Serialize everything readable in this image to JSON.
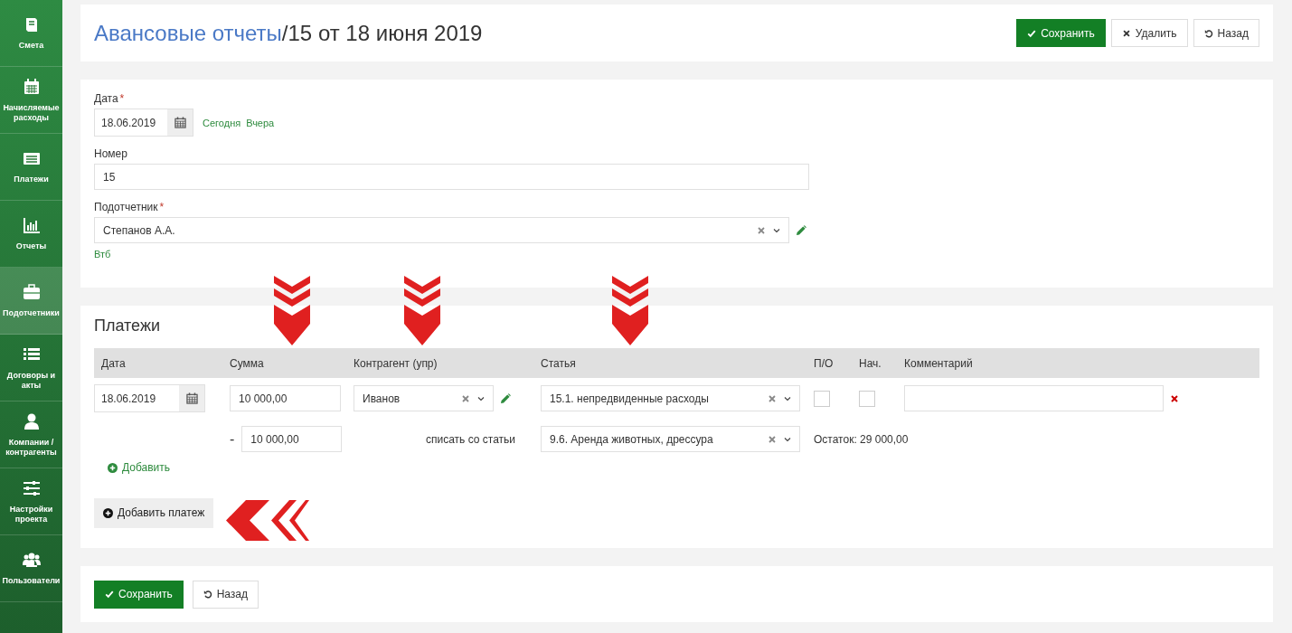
{
  "sidebar": {
    "items": [
      {
        "label": "Смета",
        "selected": false
      },
      {
        "label": "Начисляемые расходы",
        "selected": false
      },
      {
        "label": "Платежи",
        "selected": false
      },
      {
        "label": "Отчеты",
        "selected": false
      },
      {
        "label": "Подотчетники",
        "selected": true
      },
      {
        "label": "Договоры и акты",
        "selected": false
      },
      {
        "label": "Компании / контрагенты",
        "selected": false
      },
      {
        "label": "Настройки проекта",
        "selected": false
      },
      {
        "label": "Пользователи",
        "selected": false
      }
    ]
  },
  "header": {
    "breadcrumb": "Авансовые отчеты",
    "separator": "/",
    "title": "15 от 18 июня 2019",
    "buttons": [
      {
        "label": "Сохранить",
        "kind": "save"
      },
      {
        "label": "Удалить",
        "kind": "delete"
      },
      {
        "label": "Назад",
        "kind": "back"
      }
    ]
  },
  "form": {
    "date": {
      "label": "Дата",
      "required_mark": "*",
      "value": "18.06.2019",
      "quick_links": [
        "Сегодня",
        "Вчера"
      ]
    },
    "number": {
      "label": "Номер",
      "value": "15"
    },
    "accountable": {
      "label": "Подотчетник",
      "required_mark": "*",
      "value": "Степанов А.А.",
      "note": "Втб"
    }
  },
  "payments": {
    "title": "Платежи",
    "columns": [
      "Дата",
      "Сумма",
      "Контрагент (упр)",
      "Статья",
      "П/О",
      "Нач.",
      "Комментарий"
    ],
    "rows": [
      {
        "date": "18.06.2019",
        "amount": "10 000,00",
        "counterparty": "Иванов",
        "article": "15.1. непредвиденные расходы",
        "po_checked": false,
        "nach_checked": false
      }
    ],
    "writeoff": {
      "sign": "-",
      "amount": "10 000,00",
      "label": "списать со статьи",
      "article": "9.6. Аренда животных, дрессура",
      "remainder": "Остаток: 29 000,00"
    },
    "add_link": "Добавить",
    "add_payment_button": "Добавить платеж"
  },
  "footer": {
    "buttons": [
      {
        "label": "Сохранить",
        "kind": "save"
      },
      {
        "label": "Назад",
        "kind": "back"
      }
    ]
  }
}
